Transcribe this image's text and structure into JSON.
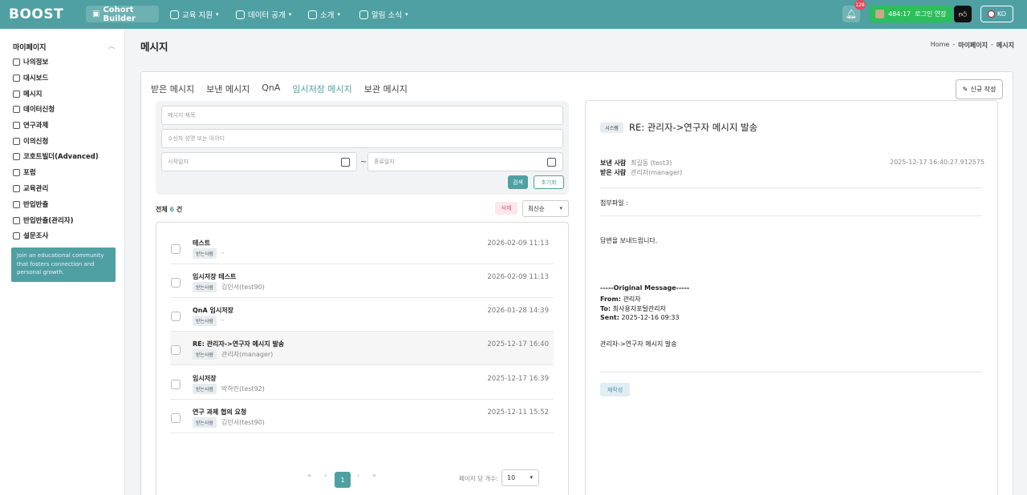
{
  "nav": {
    "logo": "BOOST",
    "cohort_builder": "Cohort Builder",
    "menus": [
      "교육 지원",
      "데이터 공개",
      "소개",
      "알림 소식"
    ],
    "notif_count": "128",
    "login_time": "484:17",
    "login_extend": "로그인 연장",
    "lang": "KO"
  },
  "sidebar": {
    "title": "마이페이지",
    "items": [
      "나의정보",
      "대시보드",
      "메시지",
      "데이터신청",
      "연구과제",
      "이의신청",
      "코호트빌더(Advanced)",
      "포럼",
      "교육관리",
      "반입반출",
      "반입반출(관리자)",
      "설문조사"
    ],
    "promo": "Join an educational community that fosters connection and personal growth."
  },
  "page": {
    "title": "메시지",
    "breadcrumb": [
      "Home",
      "마이페이지",
      "메시지"
    ]
  },
  "tabs": [
    "받은 메시지",
    "보낸 메시지",
    "QnA",
    "임시저장 메시지",
    "보관 메시지"
  ],
  "active_tab": "임시저장 메시지",
  "new_button": "신규 작성",
  "search": {
    "title_placeholder": "메시지 제목",
    "receiver_placeholder": "수신자 성명 또는 아이디",
    "start_placeholder": "시작일자",
    "end_placeholder": "종료일자",
    "tilde": "~",
    "search_btn": "검색",
    "reset_btn": "초기화"
  },
  "list": {
    "total_prefix": "전체",
    "total_count": "6",
    "total_suffix": "건",
    "delete_btn": "삭제",
    "sort": "최신순",
    "badge": "받는사람",
    "rows": [
      {
        "title": "테스트",
        "recipient": "-",
        "date": "2026-02-09 11:13"
      },
      {
        "title": "임시저장 테스트",
        "recipient": "김민서(test90)",
        "date": "2026-02-09 11:13"
      },
      {
        "title": "QnA 임시저장",
        "recipient": "-",
        "date": "2026-01-28 14:39"
      },
      {
        "title": "RE: 관리자->연구자 메시지 발송",
        "recipient": "관리자(manager)",
        "date": "2025-12-17 16:40"
      },
      {
        "title": "임시저장",
        "recipient": "박하린(test92)",
        "date": "2025-12-17 16:39"
      },
      {
        "title": "연구 과제 협의 요청",
        "recipient": "김민서(test90)",
        "date": "2025-12-11 15:52"
      }
    ],
    "pager": {
      "first": "«",
      "prev": "‹",
      "current": "1",
      "next": "›",
      "last": "»"
    },
    "per_page_label": "페이지 당 개수:",
    "per_page": "10"
  },
  "detail": {
    "badge": "시스템",
    "title": "RE: 관리자->연구자 메시지 발송",
    "sender_label": "보낸 사람",
    "sender": "최길동 (test3)",
    "receiver_label": "받은 사람",
    "receiver": "관리자(manager)",
    "timestamp": "2025-12-17 16:40:27.912575",
    "attachment_label": "첨부파일 :",
    "body1": "답변을 보내드립니다.",
    "orig_header": "-----Original Message-----",
    "from_label": "From:",
    "from": "관리자",
    "to_label": "To:",
    "to": "최사용자포털관리자",
    "sent_label": "Sent:",
    "sent": "2025-12-16 09:33",
    "body2": "관리자->연구자 메시지 발송",
    "rewrite_btn": "재작성"
  },
  "colors": {
    "brand": "#4fa0a2",
    "login_green": "#2bbf5b",
    "delete_red": "#d8536a"
  }
}
